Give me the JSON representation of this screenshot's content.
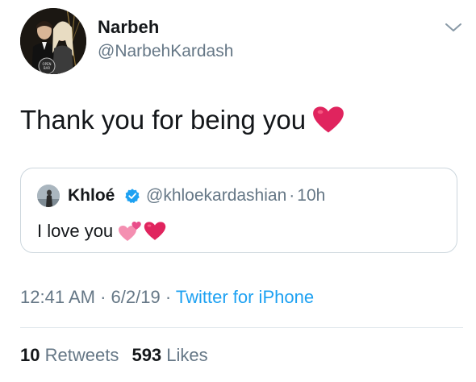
{
  "author": {
    "name": "Narbeh",
    "handle": "@NarbehKardash",
    "avatar_icon": "profile-photo"
  },
  "menu_icon": "chevron-down-icon",
  "tweet": {
    "text": "Thank you for being you",
    "emoji": "red-heart"
  },
  "quoted": {
    "name": "Khloé",
    "verified": true,
    "handle": "@khloekardashian",
    "separator": "·",
    "time": "10h",
    "text": "I love you",
    "emojis": [
      "two-hearts",
      "red-heart"
    ]
  },
  "meta": {
    "time": "12:41 AM",
    "sep1": "·",
    "date": "6/2/19",
    "sep2": "·",
    "source": "Twitter for iPhone"
  },
  "stats": {
    "retweets_count": "10",
    "retweets_label": "Retweets",
    "likes_count": "593",
    "likes_label": "Likes"
  },
  "colors": {
    "link": "#1da1f2",
    "secondary_text": "#657786",
    "primary_text": "#14171a",
    "border": "#ccd6dd",
    "heart": "#e0245e"
  }
}
